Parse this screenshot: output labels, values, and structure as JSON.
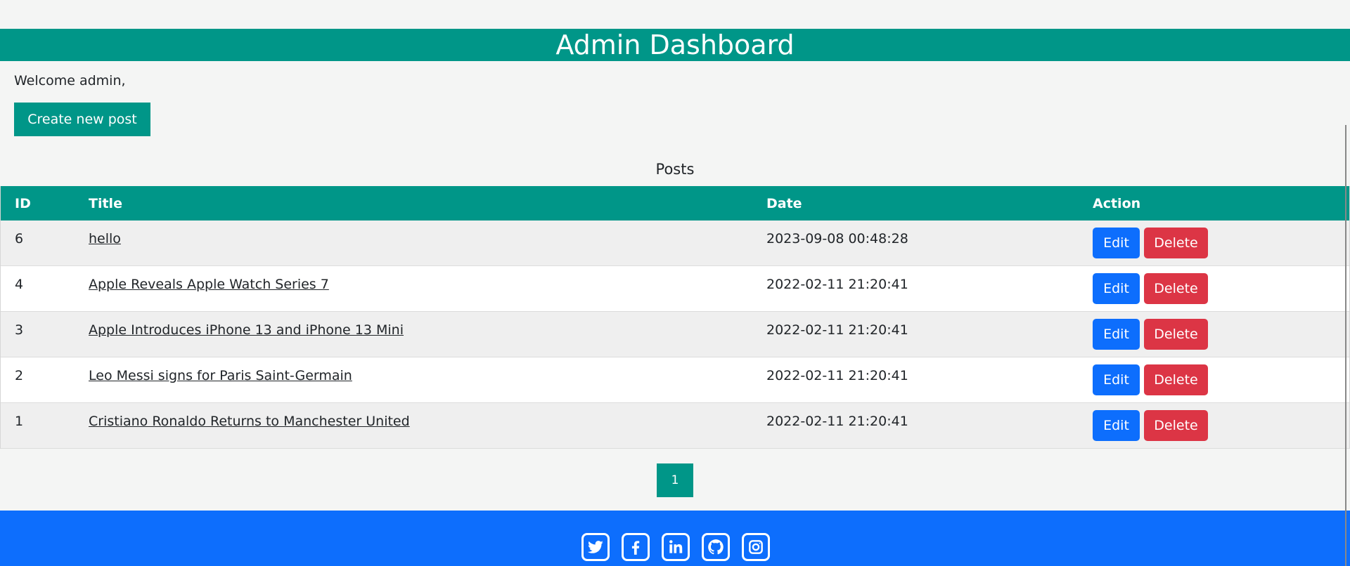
{
  "header": {
    "title": "Admin Dashboard"
  },
  "welcome": "Welcome admin,",
  "create_button": "Create new post",
  "table": {
    "caption": "Posts",
    "columns": [
      "ID",
      "Title",
      "Date",
      "Action"
    ],
    "rows": [
      {
        "id": "6",
        "title": "hello",
        "date": "2023-09-08 00:48:28"
      },
      {
        "id": "4",
        "title": "Apple Reveals Apple Watch Series 7",
        "date": "2022-02-11 21:20:41"
      },
      {
        "id": "3",
        "title": "Apple Introduces iPhone 13 and iPhone 13 Mini",
        "date": "2022-02-11 21:20:41"
      },
      {
        "id": "2",
        "title": "Leo Messi signs for Paris Saint-Germain",
        "date": "2022-02-11 21:20:41"
      },
      {
        "id": "1",
        "title": "Cristiano Ronaldo Returns to Manchester United",
        "date": "2022-02-11 21:20:41"
      }
    ],
    "edit_label": "Edit",
    "delete_label": "Delete"
  },
  "pagination": {
    "current_page": "1"
  },
  "footer": {
    "social_icons": [
      "twitter-icon",
      "facebook-icon",
      "linkedin-icon",
      "github-icon",
      "instagram-icon"
    ]
  },
  "colors": {
    "primary": "#009688",
    "edit": "#0d6efd",
    "delete": "#dc3545",
    "footer": "#0d6efd"
  }
}
